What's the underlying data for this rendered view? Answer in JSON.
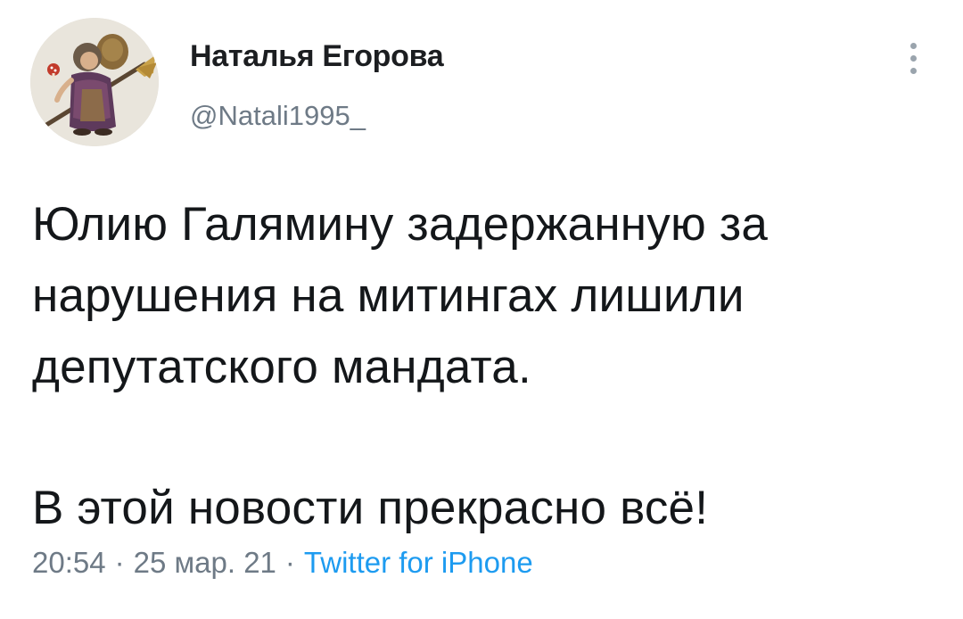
{
  "author": {
    "display_name": "Наталья Егорова",
    "handle": "@Natali1995_",
    "avatar_icon": "avatar-illustration-icon"
  },
  "tweet": {
    "paragraph_1": "Юлию Галямину задержанную за\nнарушения на митингах лишили\nдепутатского мандата.",
    "paragraph_2": "В этой новости прекрасно всё!"
  },
  "meta": {
    "time": "20:54",
    "separator": "·",
    "date": "25 мар. 21",
    "source": "Twitter for iPhone"
  },
  "colors": {
    "text": "#14171a",
    "secondary": "#6e7a86",
    "link": "#1d9bf0",
    "background": "#ffffff"
  },
  "icons": {
    "more": "more-vertical-icon"
  }
}
